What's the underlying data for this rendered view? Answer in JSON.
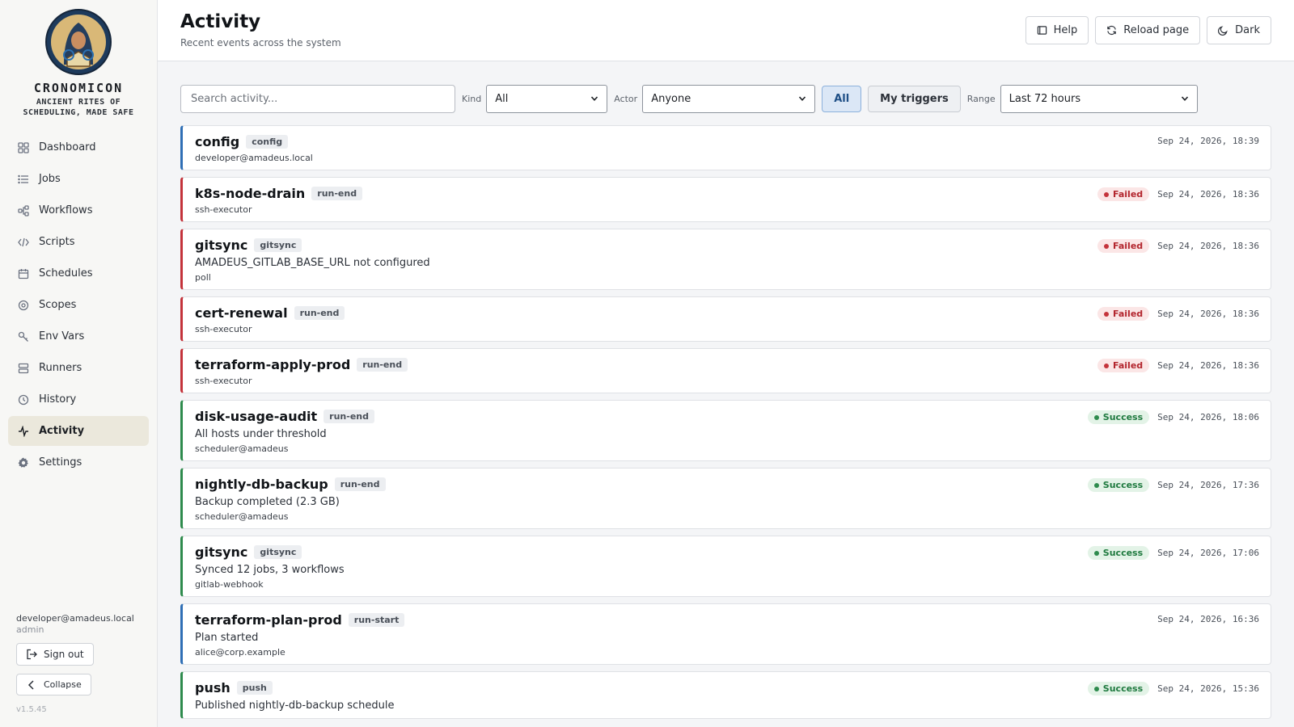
{
  "brand": {
    "name": "CRONOMICON",
    "tagline": "ANCIENT RITES OF SCHEDULING, MADE SAFE"
  },
  "sidebar": {
    "items": [
      {
        "label": "Dashboard",
        "icon": "dashboard-icon"
      },
      {
        "label": "Jobs",
        "icon": "list-icon"
      },
      {
        "label": "Workflows",
        "icon": "workflow-icon"
      },
      {
        "label": "Scripts",
        "icon": "code-icon"
      },
      {
        "label": "Schedules",
        "icon": "calendar-icon"
      },
      {
        "label": "Scopes",
        "icon": "target-icon"
      },
      {
        "label": "Env Vars",
        "icon": "key-icon"
      },
      {
        "label": "Runners",
        "icon": "server-icon"
      },
      {
        "label": "History",
        "icon": "clock-icon"
      },
      {
        "label": "Activity",
        "icon": "activity-icon",
        "active": true
      },
      {
        "label": "Settings",
        "icon": "gear-icon"
      }
    ],
    "user_email": "developer@amadeus.local",
    "user_role": "admin",
    "sign_out_label": "Sign out",
    "collapse_label": "Collapse",
    "version": "v1.5.45"
  },
  "header": {
    "title": "Activity",
    "subtitle": "Recent events across the system",
    "help_label": "Help",
    "reload_label": "Reload page",
    "theme_label": "Dark"
  },
  "filters": {
    "search_placeholder": "Search activity...",
    "kind_label": "Kind",
    "kind_value": "All",
    "actor_label": "Actor",
    "actor_value": "Anyone",
    "all_label": "All",
    "my_triggers_label": "My triggers",
    "range_label": "Range",
    "range_value": "Last 72 hours"
  },
  "colors": {
    "failed": "#c4333b",
    "success": "#2e8b4d",
    "info": "#2f6fb5",
    "active_nav": "#ebe8dc"
  },
  "events": [
    {
      "name": "config",
      "kind": "config",
      "message": "",
      "actor": "developer@amadeus.local",
      "status": "",
      "time": "Sep 24, 2026, 18:39",
      "accent": "blue"
    },
    {
      "name": "k8s-node-drain",
      "kind": "run-end",
      "message": "",
      "actor": "ssh-executor",
      "status": "Failed",
      "time": "Sep 24, 2026, 18:36",
      "accent": "red"
    },
    {
      "name": "gitsync",
      "kind": "gitsync",
      "message": "AMADEUS_GITLAB_BASE_URL not configured",
      "actor": "poll",
      "status": "Failed",
      "time": "Sep 24, 2026, 18:36",
      "accent": "red"
    },
    {
      "name": "cert-renewal",
      "kind": "run-end",
      "message": "",
      "actor": "ssh-executor",
      "status": "Failed",
      "time": "Sep 24, 2026, 18:36",
      "accent": "red"
    },
    {
      "name": "terraform-apply-prod",
      "kind": "run-end",
      "message": "",
      "actor": "ssh-executor",
      "status": "Failed",
      "time": "Sep 24, 2026, 18:36",
      "accent": "red"
    },
    {
      "name": "disk-usage-audit",
      "kind": "run-end",
      "message": "All hosts under threshold",
      "actor": "scheduler@amadeus",
      "status": "Success",
      "time": "Sep 24, 2026, 18:06",
      "accent": "green"
    },
    {
      "name": "nightly-db-backup",
      "kind": "run-end",
      "message": "Backup completed (2.3 GB)",
      "actor": "scheduler@amadeus",
      "status": "Success",
      "time": "Sep 24, 2026, 17:36",
      "accent": "green"
    },
    {
      "name": "gitsync",
      "kind": "gitsync",
      "message": "Synced 12 jobs, 3 workflows",
      "actor": "gitlab-webhook",
      "status": "Success",
      "time": "Sep 24, 2026, 17:06",
      "accent": "green"
    },
    {
      "name": "terraform-plan-prod",
      "kind": "run-start",
      "message": "Plan started",
      "actor": "alice@corp.example",
      "status": "",
      "time": "Sep 24, 2026, 16:36",
      "accent": "blue"
    },
    {
      "name": "push",
      "kind": "push",
      "message": "Published nightly-db-backup schedule",
      "actor": "",
      "status": "Success",
      "time": "Sep 24, 2026, 15:36",
      "accent": "green"
    }
  ]
}
